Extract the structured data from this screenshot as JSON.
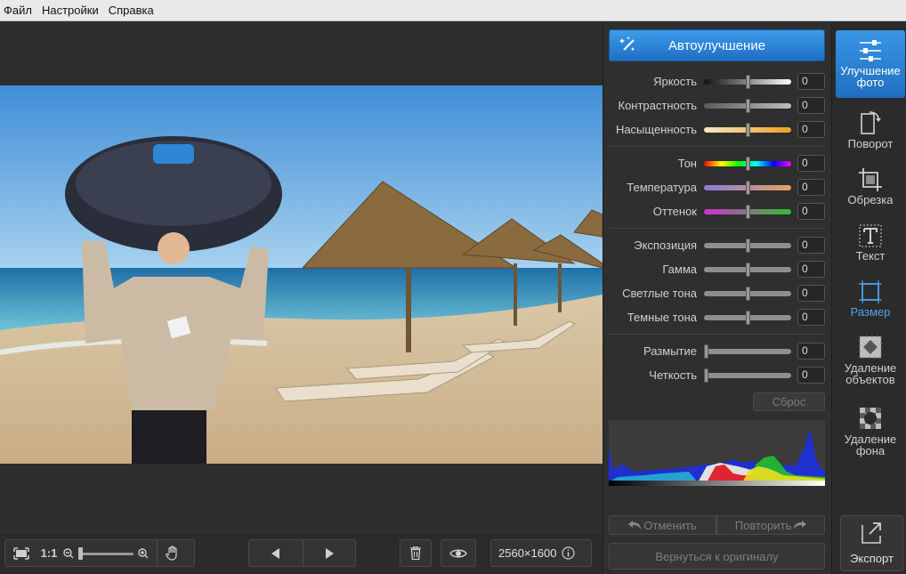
{
  "menu": {
    "file": "Файл",
    "settings": "Настройки",
    "help": "Справка"
  },
  "panel": {
    "auto_enhance": "Автоулучшение",
    "adjustments": [
      {
        "label": "Яркость",
        "value": "0"
      },
      {
        "label": "Контрастность",
        "value": "0"
      },
      {
        "label": "Насыщенность",
        "value": "0"
      },
      {
        "label": "Тон",
        "value": "0"
      },
      {
        "label": "Температура",
        "value": "0"
      },
      {
        "label": "Оттенок",
        "value": "0"
      },
      {
        "label": "Экспозиция",
        "value": "0"
      },
      {
        "label": "Гамма",
        "value": "0"
      },
      {
        "label": "Светлые тона",
        "value": "0"
      },
      {
        "label": "Темные тона",
        "value": "0"
      },
      {
        "label": "Размытие",
        "value": "0"
      },
      {
        "label": "Четкость",
        "value": "0"
      }
    ],
    "reset": "Сброс",
    "undo": "Отменить",
    "redo": "Повторить",
    "revert": "Вернуться к оригиналу"
  },
  "sidebar": {
    "tools": [
      {
        "label": "Улучшение фото"
      },
      {
        "label": "Поворот"
      },
      {
        "label": "Обрезка"
      },
      {
        "label": "Текст"
      },
      {
        "label": "Размер"
      },
      {
        "label": "Удаление объектов"
      },
      {
        "label": "Удаление фона"
      }
    ],
    "export": "Экспорт"
  },
  "bottom": {
    "zoom_11": "1:1",
    "resolution": "2560×1600"
  },
  "colors": {
    "accent": "#2a86dc",
    "active_tool_text": "#4fa3f0"
  }
}
